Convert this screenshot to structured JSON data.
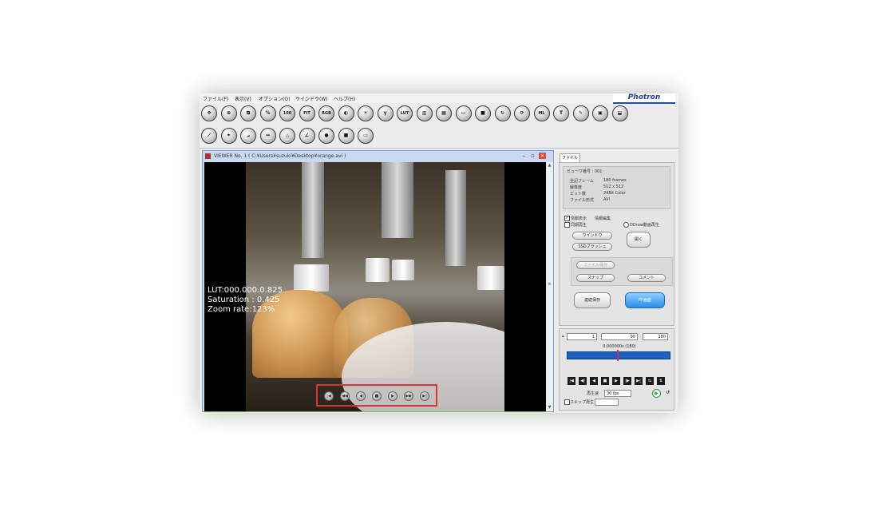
{
  "menu": {
    "file": "ファイル(F)",
    "view": "表示(V)",
    "options": "オプション(O)",
    "window": "ウインドウ(W)",
    "help": "ヘルプ(H)"
  },
  "brand": "Photron",
  "toolbar1": [
    {
      "name": "move-icon",
      "text": "✥"
    },
    {
      "name": "zoom-in-icon",
      "text": "⊕"
    },
    {
      "name": "crop-icon",
      "text": "⧉"
    },
    {
      "name": "percent-icon",
      "text": "%"
    },
    {
      "name": "zoom-100-icon",
      "text": "100"
    },
    {
      "name": "fit-icon",
      "text": "FIT"
    },
    {
      "name": "rgb-icon",
      "text": "RGB"
    },
    {
      "name": "contrast-icon",
      "text": "◐"
    },
    {
      "name": "brightness-icon",
      "text": "☀"
    },
    {
      "name": "gamma-icon",
      "text": "γ"
    },
    {
      "name": "lut-reset-icon",
      "text": "LUT"
    },
    {
      "name": "color-bars-icon",
      "text": "▥"
    },
    {
      "name": "color-grid-icon",
      "text": "▦"
    },
    {
      "name": "frame-icon",
      "text": "▭"
    },
    {
      "name": "multi-color-icon",
      "text": "■"
    },
    {
      "name": "rotate-icon",
      "text": "↻"
    },
    {
      "name": "refresh-icon",
      "text": "⟳"
    },
    {
      "name": "multi-lock-icon",
      "text": "ML"
    },
    {
      "name": "text-tool-icon",
      "text": "T"
    },
    {
      "name": "pen-icon",
      "text": "✎"
    },
    {
      "name": "display-icon",
      "text": "▣"
    },
    {
      "name": "tray-icon",
      "text": "⬓"
    }
  ],
  "toolbar2": [
    {
      "name": "measure-line-icon",
      "text": "⟋"
    },
    {
      "name": "tracking-icon",
      "text": "⌖"
    },
    {
      "name": "angle-icon",
      "text": "⦟"
    },
    {
      "name": "distance-icon",
      "text": "↔"
    },
    {
      "name": "triangle-icon",
      "text": "△"
    },
    {
      "name": "slope-icon",
      "text": "∠"
    },
    {
      "name": "point-icon",
      "text": "●"
    },
    {
      "name": "gray-tile-icon",
      "text": "■"
    },
    {
      "name": "window-icon",
      "text": "▭"
    }
  ],
  "viewer": {
    "title": "VIEWER No. 1 ( C:¥Users¥suzuki¥Desktop¥orange.avi )"
  },
  "overlay": {
    "lut": "LUT:000.000.0.825",
    "saturation": "Saturation : 0.425",
    "zoom": "Zoom rate:123%"
  },
  "playback_controls": [
    "|◀",
    "◀◀",
    "◀",
    "■",
    "▶",
    "▶▶",
    "▶|"
  ],
  "panel": {
    "tab": "ファイル",
    "viewer_no": "ビューワ番号 : 001",
    "info": [
      {
        "k": "全記フレーム",
        "v": "180 frames"
      },
      {
        "k": "解像度",
        "v": "512 x 512"
      },
      {
        "k": "ビット数",
        "v": "24Bit Color"
      },
      {
        "k": "ファイル形式",
        "v": "AVI"
      }
    ],
    "chk_info": "情報表示",
    "chk_info2": "情報編集",
    "chk_sync": "同期再生",
    "chk_ddraw": "DDraw動画再生",
    "btn_window": "ウインドウ",
    "btn_ssd": "SSDフラッシュ",
    "btn_open": "開く",
    "btn_disabled": "ファイル保存",
    "btn_snap": "スナップ",
    "btn_comment": "コメント",
    "btn_tool": "連続保存",
    "btn_ff": "FF画面"
  },
  "playback": {
    "start": "1",
    "current": "90",
    "end": "180",
    "time": "0.000000s (180)",
    "speed_label": "再生速",
    "speed": "30 fps",
    "skip_label": "スキップ再生",
    "buttons": [
      "|◀",
      "◀|",
      "◀",
      "■",
      "▶",
      "|▶",
      "▶|",
      "⇆",
      "⇅"
    ]
  }
}
